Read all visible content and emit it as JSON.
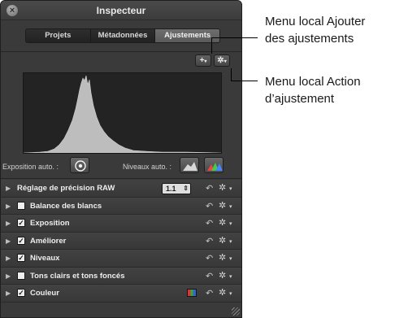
{
  "window": {
    "title": "Inspecteur"
  },
  "tabs": [
    {
      "label": "Projets",
      "active": false
    },
    {
      "label": "Métadonnées",
      "active": false
    },
    {
      "label": "Ajustements",
      "active": true
    }
  ],
  "toolbar": {
    "add_label": "+",
    "action_icon": "gear-icon"
  },
  "auto_controls": {
    "exposure_label": "Exposition auto. :",
    "levels_label": "Niveaux auto. :"
  },
  "adjustments": [
    {
      "label": "Réglage de précision RAW",
      "has_checkbox": false,
      "checked": false,
      "value": "1.1",
      "extra": "precision"
    },
    {
      "label": "Balance des blancs",
      "has_checkbox": true,
      "checked": false,
      "extra": null
    },
    {
      "label": "Exposition",
      "has_checkbox": true,
      "checked": true,
      "extra": null
    },
    {
      "label": "Améliorer",
      "has_checkbox": true,
      "checked": true,
      "extra": null
    },
    {
      "label": "Niveaux",
      "has_checkbox": true,
      "checked": true,
      "extra": null
    },
    {
      "label": "Tons clairs et tons foncés",
      "has_checkbox": true,
      "checked": false,
      "extra": null
    },
    {
      "label": "Couleur",
      "has_checkbox": true,
      "checked": true,
      "extra": "color"
    }
  ],
  "callouts": [
    {
      "line1": "Menu local Ajouter",
      "line2": "des ajustements"
    },
    {
      "line1": "Menu local Action",
      "line2": "d’ajustement"
    }
  ],
  "colors": {
    "panel_bg": "#3a3a3a",
    "histogram_fill": "#b8b8b8",
    "active_tab": "#646464"
  }
}
